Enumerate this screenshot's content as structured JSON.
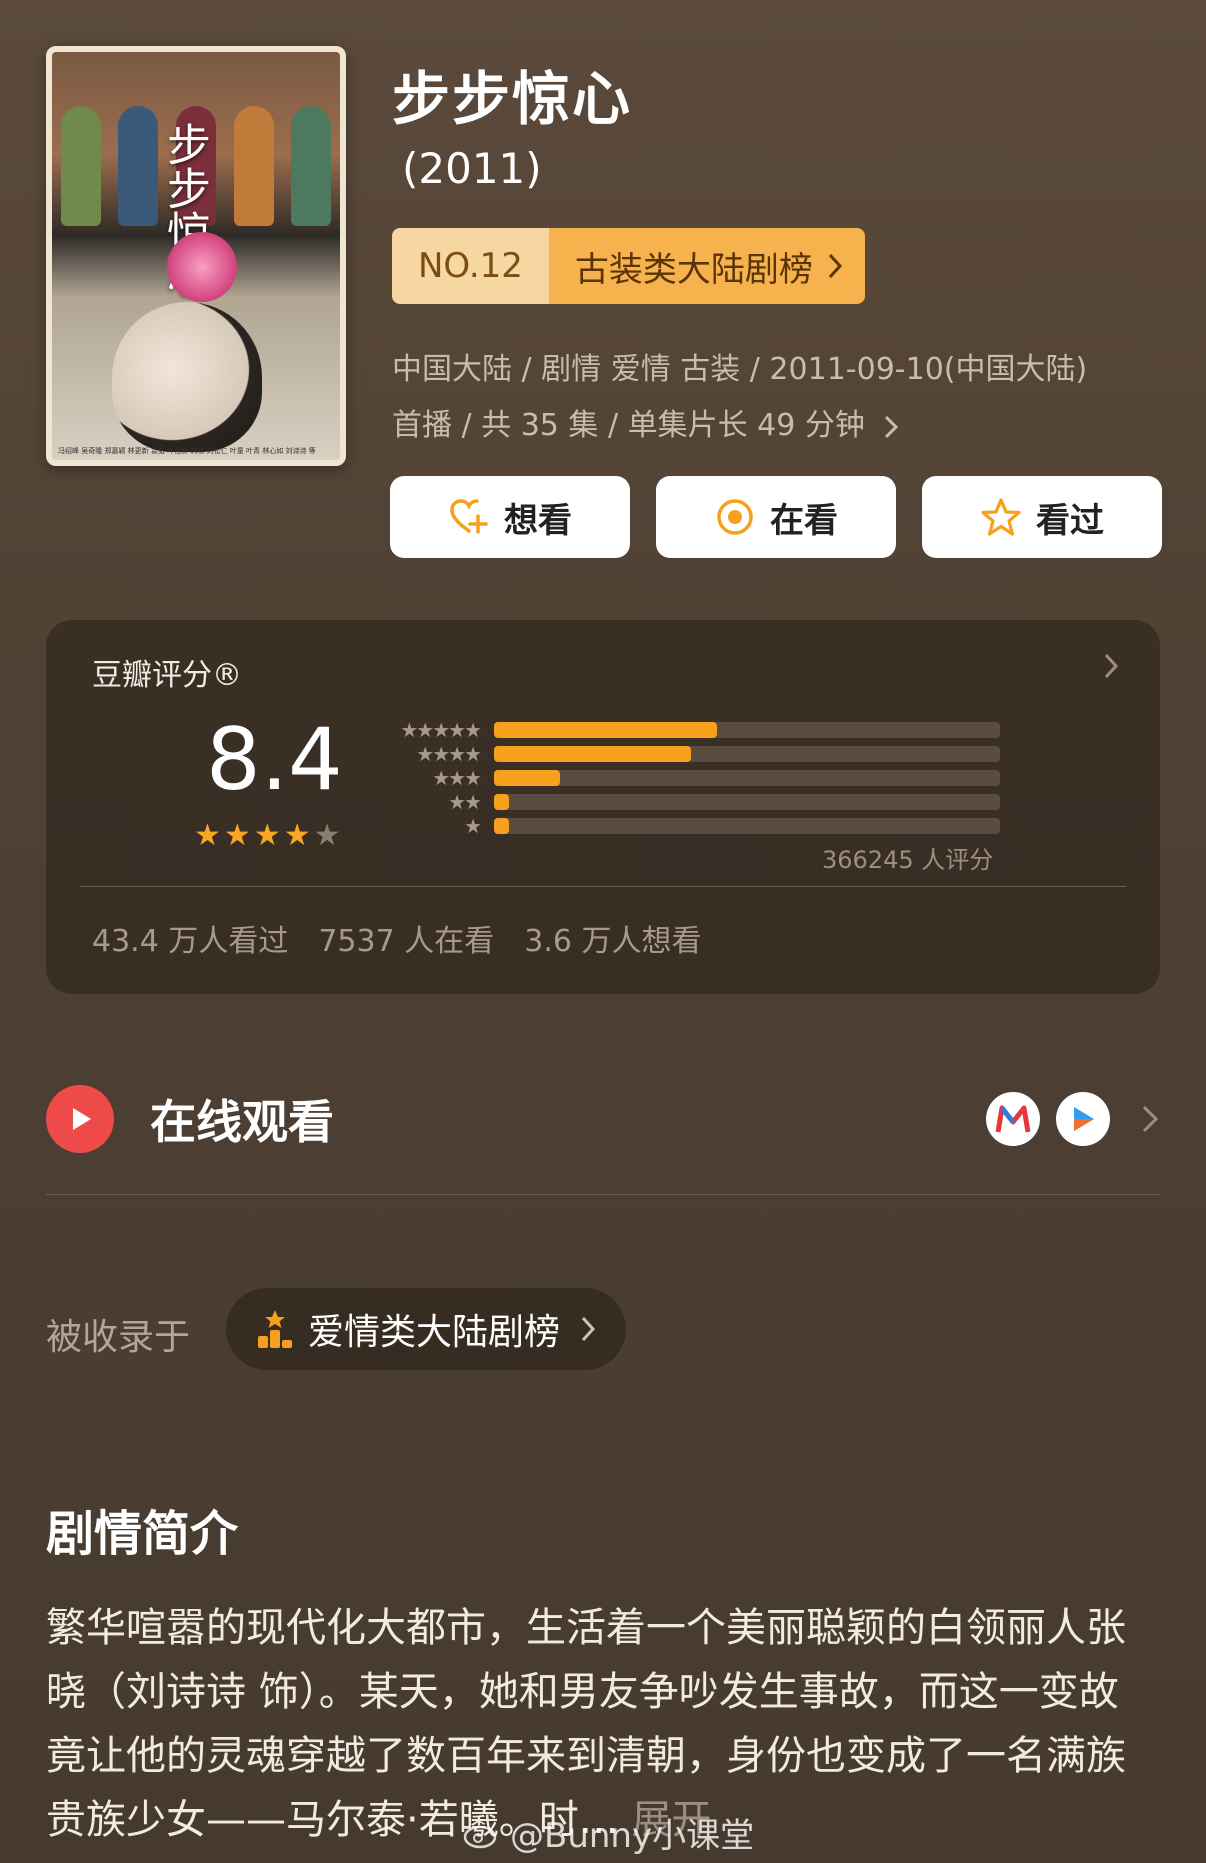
{
  "header": {
    "title": "步步惊心",
    "year": "(2011)",
    "poster": {
      "title_art": "步步惊心",
      "credits": "冯绍峰 吴奇隆 郑嘉颖 林更新 袁弘 叶祖新 韩栋 刘松仁 叶童 叶青 林心如 刘诗诗 等"
    },
    "rank": {
      "number": "NO.12",
      "list": "古装类大陆剧榜"
    },
    "meta_line1": "中国大陆 / 剧情 爱情 古装 / 2011-09-10(中国大陆)",
    "meta_line2": "首播 / 共 35 集 / 单集片长 49 分钟"
  },
  "actions": {
    "want": "想看",
    "watching": "在看",
    "watched": "看过"
  },
  "rating": {
    "title": "豆瓣评分®",
    "score": "8.4",
    "stars_filled": 4,
    "distribution": [
      {
        "stars": "★★★★★",
        "fraction": 0.44
      },
      {
        "stars": "★★★★",
        "fraction": 0.39
      },
      {
        "stars": "★★★",
        "fraction": 0.13
      },
      {
        "stars": "★★",
        "fraction": 0.03
      },
      {
        "stars": "★",
        "fraction": 0.03
      }
    ],
    "count_text": "366245 人评分",
    "stats": {
      "watched": "43.4 万人看过",
      "watching": "7537 人在看",
      "want": "3.6 万人想看"
    }
  },
  "watch": {
    "label": "在线观看"
  },
  "included": {
    "label": "被收录于",
    "list": "爱情类大陆剧榜"
  },
  "synopsis": {
    "title": "剧情简介",
    "text": "繁华喧嚣的现代化大都市，生活着一个美丽聪颖的白领丽人张晓（刘诗诗 饰）。某天，她和男友争吵发生事故，而这一变故竟让他的灵魂穿越了数百年来到清朝，身份也变成了一名满族贵族少女——马尔泰·若曦。时…",
    "more": "展开"
  },
  "watermark": "@Bunny小课堂",
  "colors": {
    "accent": "#f6a01b",
    "play_red": "#ef4a4a"
  }
}
